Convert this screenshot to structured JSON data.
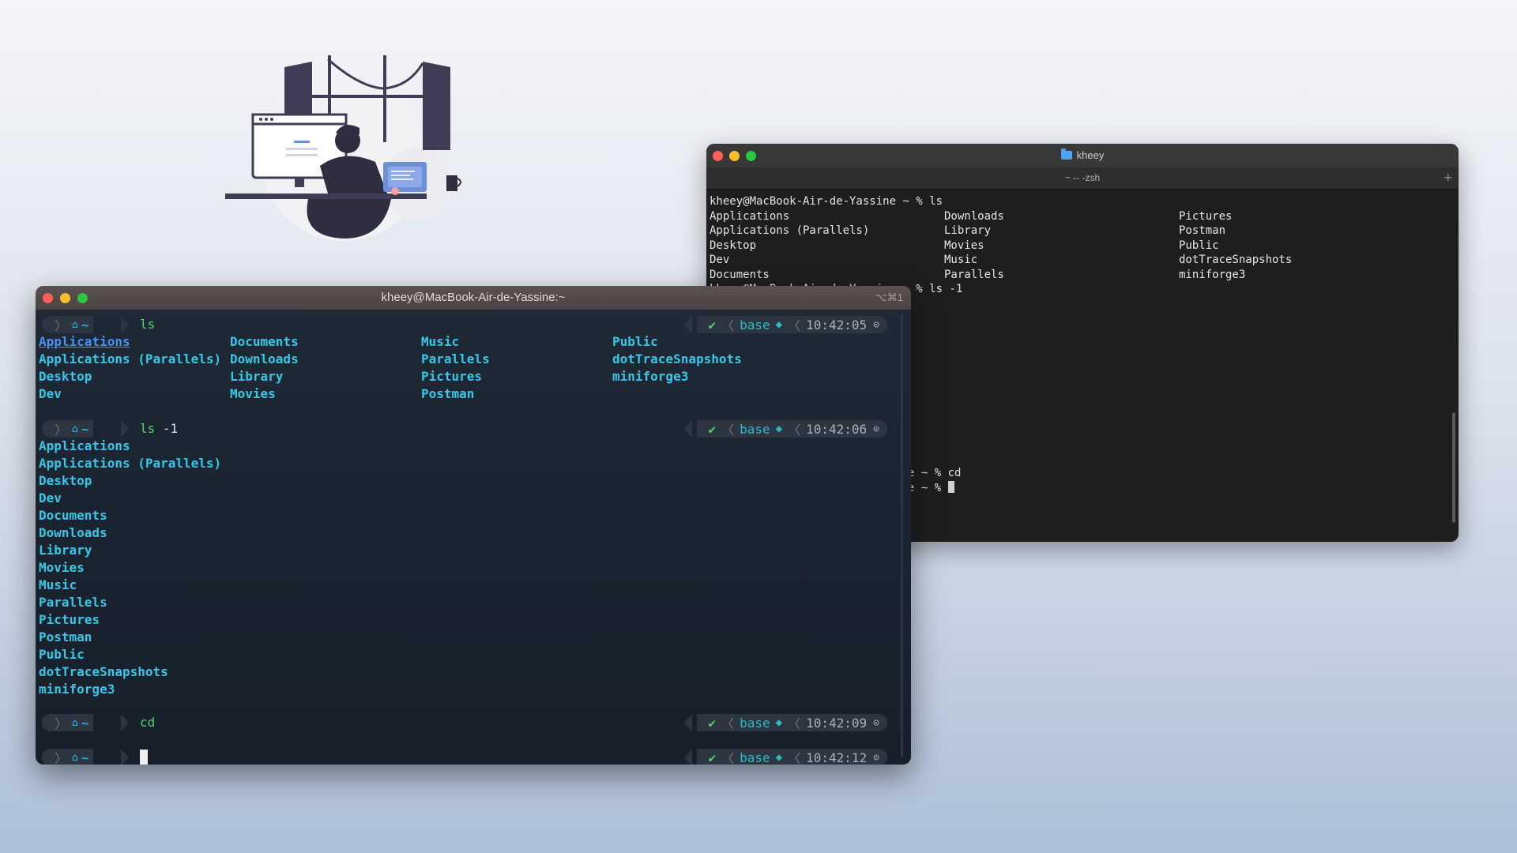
{
  "colors": {
    "page_bg_top": "#f4f5f8",
    "page_bg_bottom": "#aebfd6",
    "dir_text": "#35c8e8",
    "link_text": "#4a90f5",
    "cmd_text": "#4fd16f",
    "env_text": "#2fb9c6"
  },
  "illustration": {
    "icon": "developer-at-desk-illustration"
  },
  "back_terminal": {
    "window_title": "kheey",
    "tab_title": "~ -- -zsh",
    "lines": [
      "kheey@MacBook-Air-de-Yassine ~ % ls"
    ],
    "ls_grid": [
      [
        "Applications",
        "Downloads",
        "Pictures"
      ],
      [
        "Applications (Parallels)",
        "Library",
        "Postman"
      ],
      [
        "Desktop",
        "Movies",
        "Public"
      ],
      [
        "Dev",
        "Music",
        "dotTraceSnapshots"
      ],
      [
        "Documents",
        "Parallels",
        "miniforge3"
      ]
    ],
    "line_after_grid": "kheey@MacBook-Air-de-Yassine ~ % ls -1",
    "bottom_lines": [
      "e ~ % cd",
      "e ~ % "
    ]
  },
  "front_terminal": {
    "window_title": "kheey@MacBook-Air-de-Yassine:~",
    "shortcut": "⌥⌘1",
    "prompt": {
      "apple_icon": "apple-icon",
      "home_icon": "home-icon",
      "dir": "~",
      "status_icon": "check-icon",
      "env": "base",
      "clock_icon": "clock-icon"
    },
    "prompts": [
      {
        "cmd": "ls",
        "flag": "",
        "time": "10:42:05"
      },
      {
        "cmd": "ls",
        "flag": "-1",
        "time": "10:42:06"
      },
      {
        "cmd": "cd",
        "flag": "",
        "time": "10:42:09"
      },
      {
        "cmd": "",
        "flag": "",
        "time": "10:42:12"
      }
    ],
    "ls_grid": [
      [
        "Applications",
        "Documents",
        "Music",
        "Public"
      ],
      [
        "Applications (Parallels)",
        "Downloads",
        "Parallels",
        "dotTraceSnapshots"
      ],
      [
        "Desktop",
        "Library",
        "Pictures",
        "miniforge3"
      ],
      [
        "Dev",
        "Movies",
        "Postman",
        ""
      ]
    ],
    "ls_list": [
      "Applications",
      "Applications (Parallels)",
      "Desktop",
      "Dev",
      "Documents",
      "Downloads",
      "Library",
      "Movies",
      "Music",
      "Parallels",
      "Pictures",
      "Postman",
      "Public",
      "dotTraceSnapshots",
      "miniforge3"
    ]
  }
}
